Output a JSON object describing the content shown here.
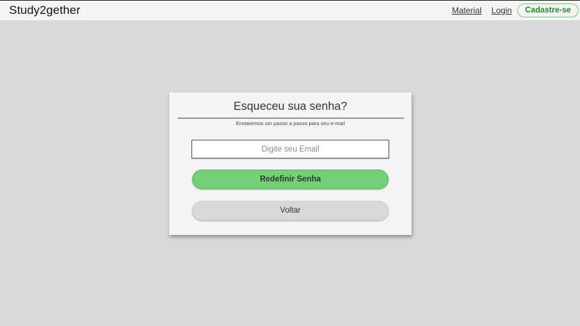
{
  "header": {
    "brand": "Study2gether",
    "nav": {
      "material": "Material",
      "login": "Login",
      "signup": "Cadastre-se"
    }
  },
  "card": {
    "title": "Esqueceu sua senha?",
    "subtitle": "Enviaremos um passo a passo para seu e-mail",
    "email": {
      "placeholder": "Digite seu Email",
      "value": ""
    },
    "reset_button": "Redefinir Senha",
    "back_button": "Voltar"
  },
  "colors": {
    "page_background": "#d9d9d9",
    "card_background": "#f4f4f4",
    "primary_green": "#74d077",
    "signup_green": "#1f8f2a"
  }
}
